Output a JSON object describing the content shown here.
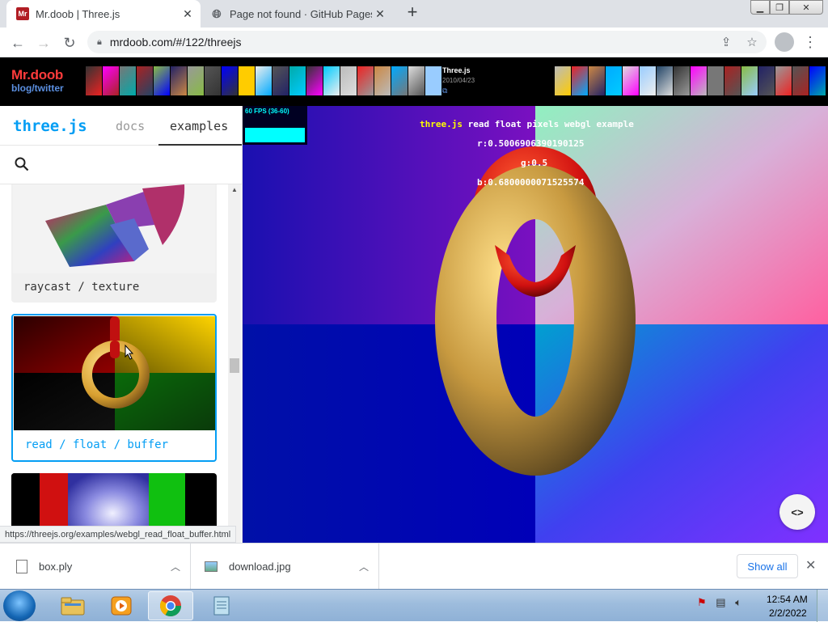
{
  "browser": {
    "tabs": [
      {
        "title": "Mr.doob | Three.js",
        "favicon": "mr-favicon",
        "active": true
      },
      {
        "title": "Page not found · GitHub Pages",
        "favicon": "globe-icon",
        "active": false
      }
    ],
    "url": "mrdoob.com/#/122/threejs",
    "status_url": "https://threejs.org/examples/webgl_read_float_buffer.html"
  },
  "banner": {
    "logo": "Mr.doob",
    "sub": "blog/twitter",
    "project_name": "Three.js",
    "project_date": "2010/04/23",
    "project_link": "⧉"
  },
  "sidebar": {
    "logo": "three.js",
    "tab_docs": "docs",
    "tab_examples": "examples",
    "cards": [
      {
        "label": "raycast / texture"
      },
      {
        "label": "read / float / buffer",
        "selected": true
      }
    ]
  },
  "viewer": {
    "fps": "60 FPS (36-60)",
    "title_prefix": "three.js",
    "title_rest": " read float pixels webgl example",
    "r": "r:0.5006906390190125",
    "g": "g:0.5",
    "b": "b:0.6800000071525574",
    "code_button": "<>"
  },
  "downloads": {
    "items": [
      {
        "name": "box.ply",
        "icon": "file-icon"
      },
      {
        "name": "download.jpg",
        "icon": "image-file-icon"
      }
    ],
    "show_all": "Show all"
  },
  "taskbar": {
    "time": "12:54 AM",
    "date": "2/2/2022"
  },
  "colors": {
    "accent": "#049ef4",
    "banner_red": "#ff3b3b",
    "canvas_blue": "#0000aa"
  }
}
